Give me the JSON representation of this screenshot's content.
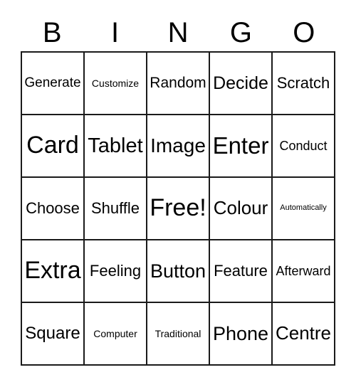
{
  "card": {
    "title": "BINGO",
    "header_letters": [
      "B",
      "I",
      "N",
      "G",
      "O"
    ],
    "colors": {
      "background": "#ffffff",
      "border": "#1a1a1a",
      "text": "#000000"
    },
    "grid": {
      "columns": 5,
      "rows": 5,
      "free_space": "Free!",
      "free_space_position": "center"
    },
    "rows": [
      [
        {
          "label": "Generate",
          "size": "md"
        },
        {
          "label": "Customize",
          "size": "xs"
        },
        {
          "label": "Random",
          "size": "md"
        },
        {
          "label": "Decide",
          "size": "lg"
        },
        {
          "label": "Scratch",
          "size": "md"
        }
      ],
      [
        {
          "label": "Card",
          "size": "xxl"
        },
        {
          "label": "Tablet",
          "size": "xl"
        },
        {
          "label": "Image",
          "size": "xl"
        },
        {
          "label": "Enter",
          "size": "xxl"
        },
        {
          "label": "Conduct",
          "size": "sm"
        }
      ],
      [
        {
          "label": "Choose",
          "size": "md"
        },
        {
          "label": "Shuffle",
          "size": "md"
        },
        {
          "label": "Free!",
          "size": "xxl"
        },
        {
          "label": "Colour",
          "size": "lg"
        },
        {
          "label": "Automatically",
          "size": "xxs"
        }
      ],
      [
        {
          "label": "Extra",
          "size": "xxl"
        },
        {
          "label": "Feeling",
          "size": "md"
        },
        {
          "label": "Button",
          "size": "xl"
        },
        {
          "label": "Feature",
          "size": "md"
        },
        {
          "label": "Afterward",
          "size": "sm"
        }
      ],
      [
        {
          "label": "Square",
          "size": "xl"
        },
        {
          "label": "Computer",
          "size": "xs"
        },
        {
          "label": "Traditional",
          "size": "xs"
        },
        {
          "label": "Phone",
          "size": "xl"
        },
        {
          "label": "Centre",
          "size": "xl"
        }
      ]
    ]
  }
}
